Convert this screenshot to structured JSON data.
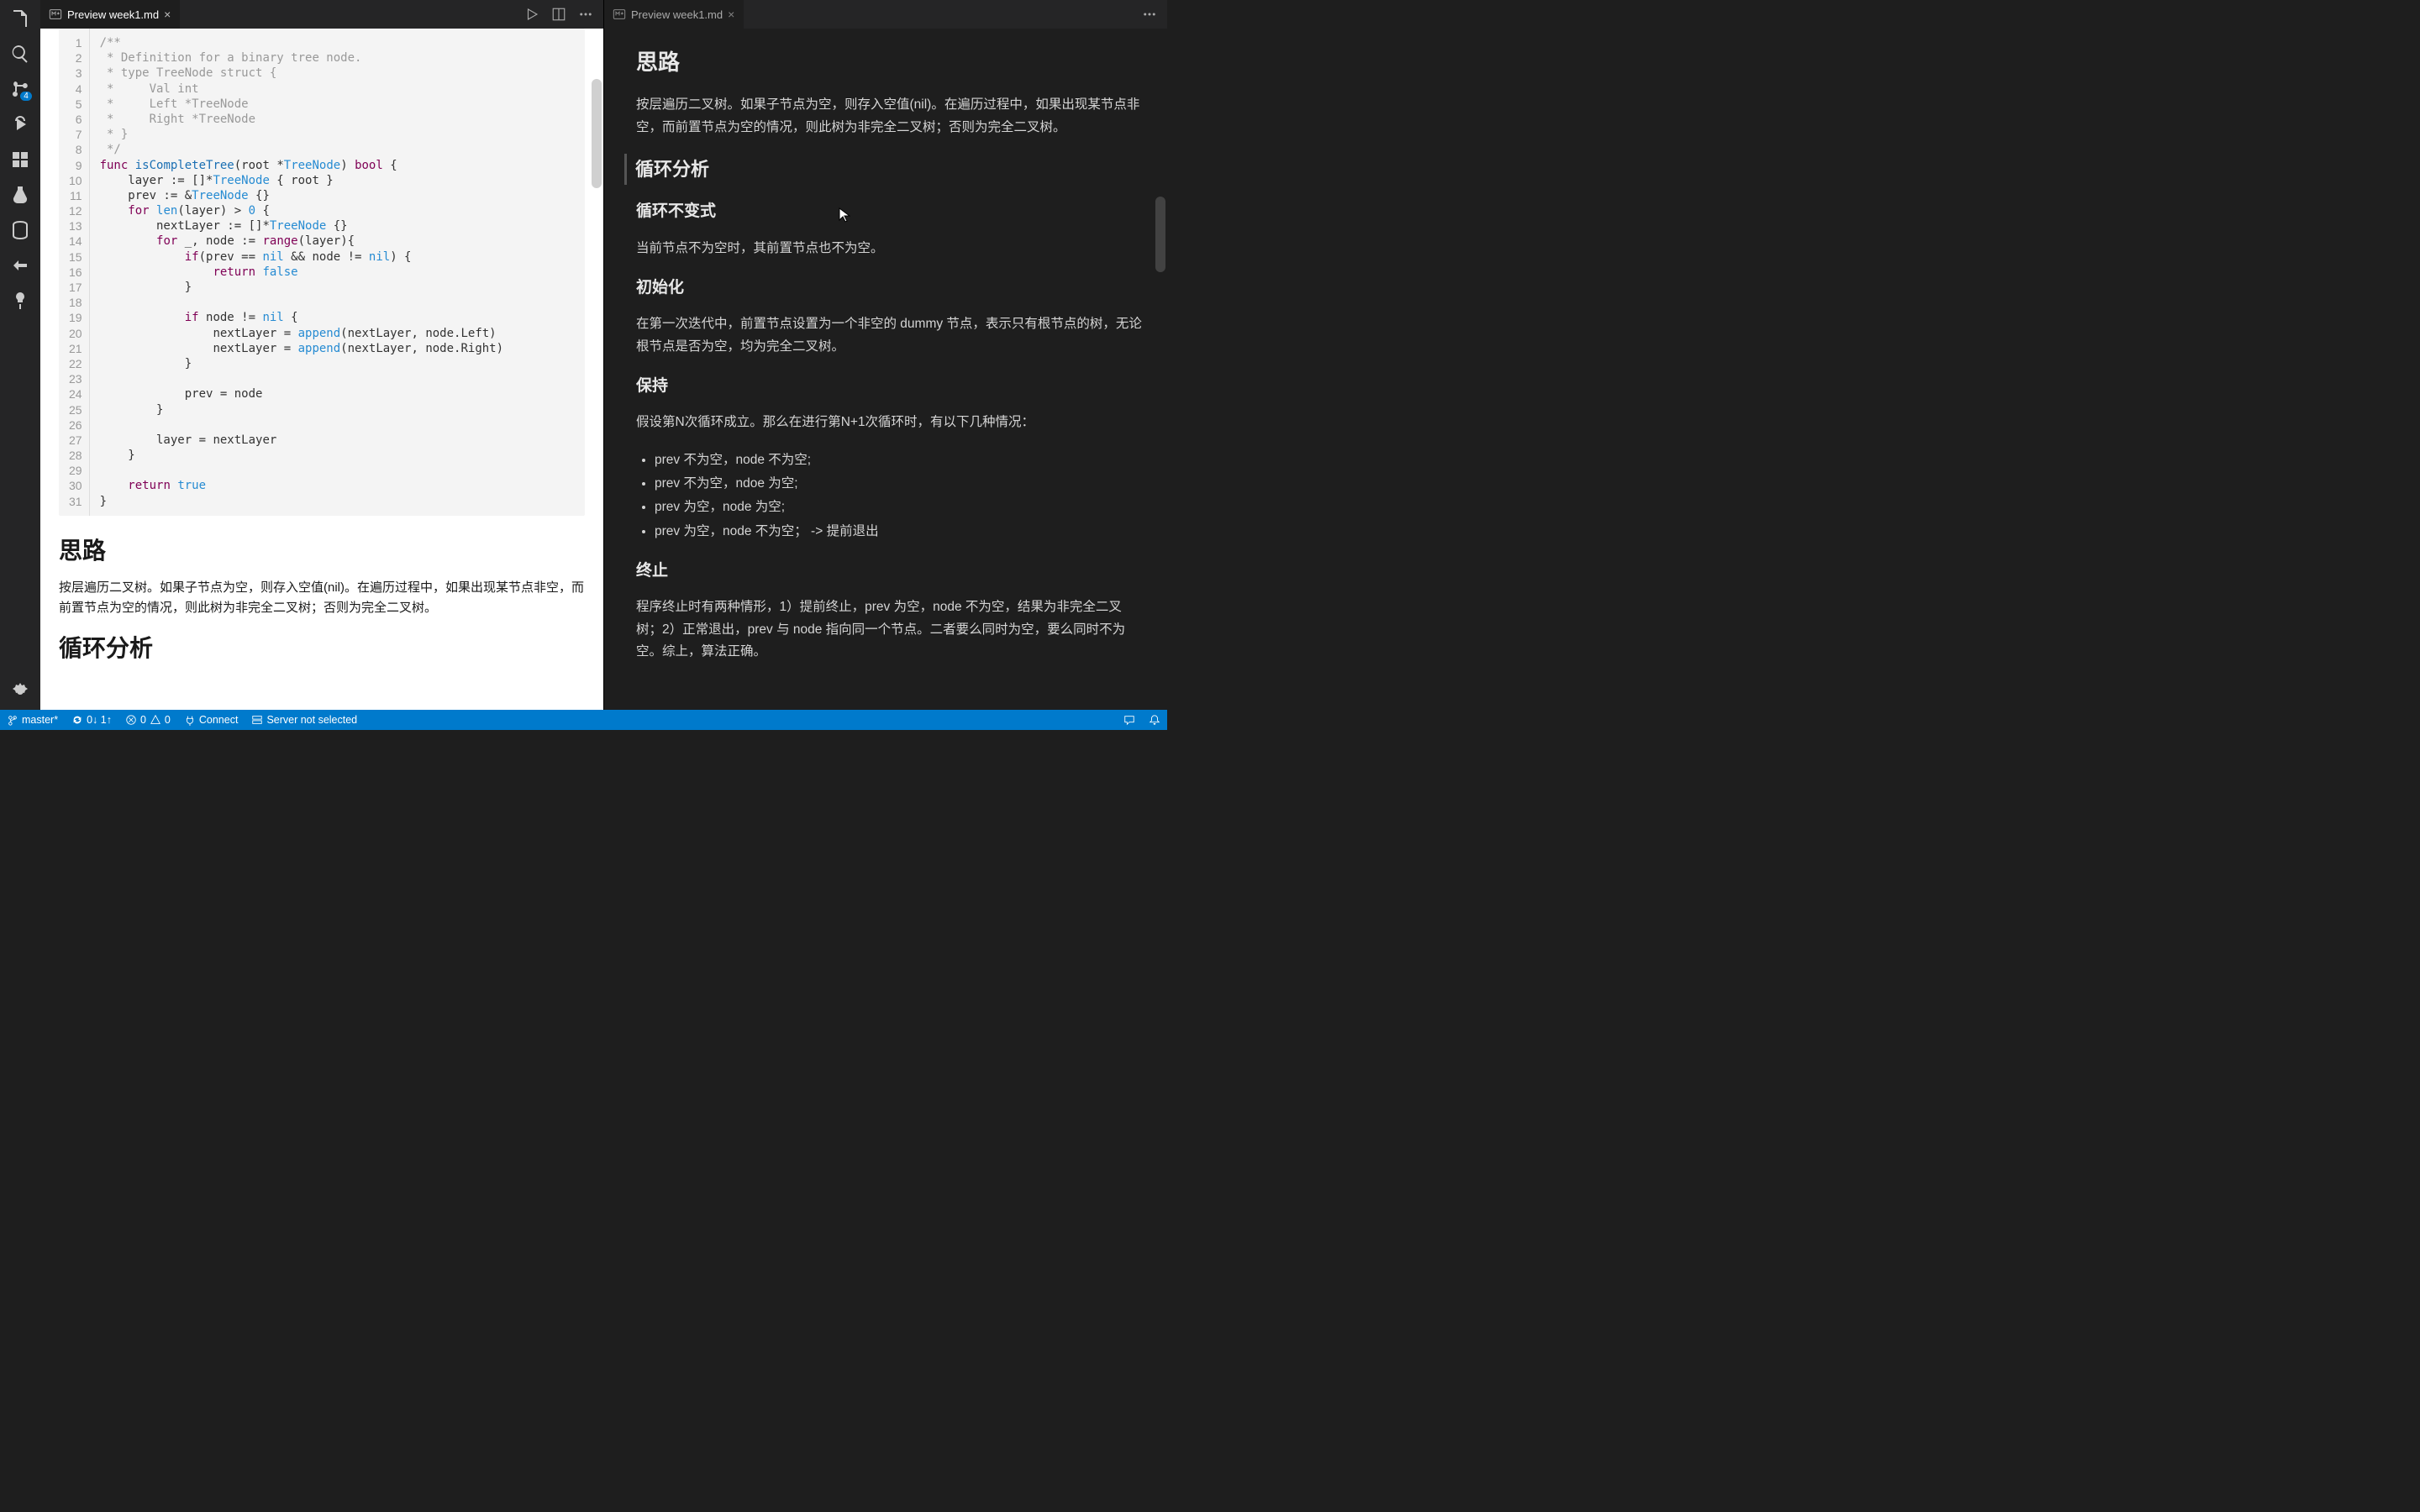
{
  "tabs": {
    "left": {
      "label": "Preview week1.md"
    },
    "right": {
      "label": "Preview week1.md"
    }
  },
  "activity": {
    "scm_badge": "4"
  },
  "code": {
    "lines": [
      "/**",
      " * Definition for a binary tree node.",
      " * type TreeNode struct {",
      " *     Val int",
      " *     Left *TreeNode",
      " *     Right *TreeNode",
      " * }",
      " */",
      "func isCompleteTree(root *TreeNode) bool {",
      "    layer := []*TreeNode { root }",
      "    prev := &TreeNode {}",
      "    for len(layer) > 0 {",
      "        nextLayer := []*TreeNode {}",
      "        for _, node := range(layer){",
      "            if(prev == nil && node != nil) {",
      "                return false",
      "            }",
      "",
      "            if node != nil {",
      "                nextLayer = append(nextLayer, node.Left)",
      "                nextLayer = append(nextLayer, node.Right)",
      "            }",
      "",
      "            prev = node",
      "        }",
      "",
      "        layer = nextLayer",
      "    }",
      "",
      "    return true",
      "}"
    ]
  },
  "md_left": {
    "h1": "思路",
    "p1": "按层遍历二叉树。如果子节点为空，则存入空值(nil)。在遍历过程中，如果出现某节点非空，而前置节点为空的情况，则此树为非完全二叉树；否则为完全二叉树。",
    "h2": "循环分析"
  },
  "md_right": {
    "h1": "思路",
    "p1": "按层遍历二叉树。如果子节点为空，则存入空值(nil)。在遍历过程中，如果出现某节点非空，而前置节点为空的情况，则此树为非完全二叉树；否则为完全二叉树。",
    "h2": "循环分析",
    "h3a": "循环不变式",
    "pa": "当前节点不为空时，其前置节点也不为空。",
    "h3b": "初始化",
    "pb": "在第一次迭代中，前置节点设置为一个非空的 dummy 节点，表示只有根节点的树，无论根节点是否为空，均为完全二叉树。",
    "h3c": "保持",
    "pc": "假设第N次循环成立。那么在进行第N+1次循环时，有以下几种情况：",
    "li1": "prev 不为空，node 不为空;",
    "li2": "prev 不为空，ndoe 为空;",
    "li3": "prev 为空，node 为空;",
    "li4": "prev 为空，node 不为空；  -> 提前退出",
    "h3d": "终止",
    "pd": "程序终止时有两种情形，1）提前终止，prev 为空，node 不为空，结果为非完全二叉树；2）正常退出，prev 与 node 指向同一个节点。二者要么同时为空，要么同时不为空。综上，算法正确。"
  },
  "status": {
    "branch": "master*",
    "sync": "0↓ 1↑",
    "errors": "0",
    "warnings": "0",
    "connect": "Connect",
    "server": "Server not selected"
  }
}
